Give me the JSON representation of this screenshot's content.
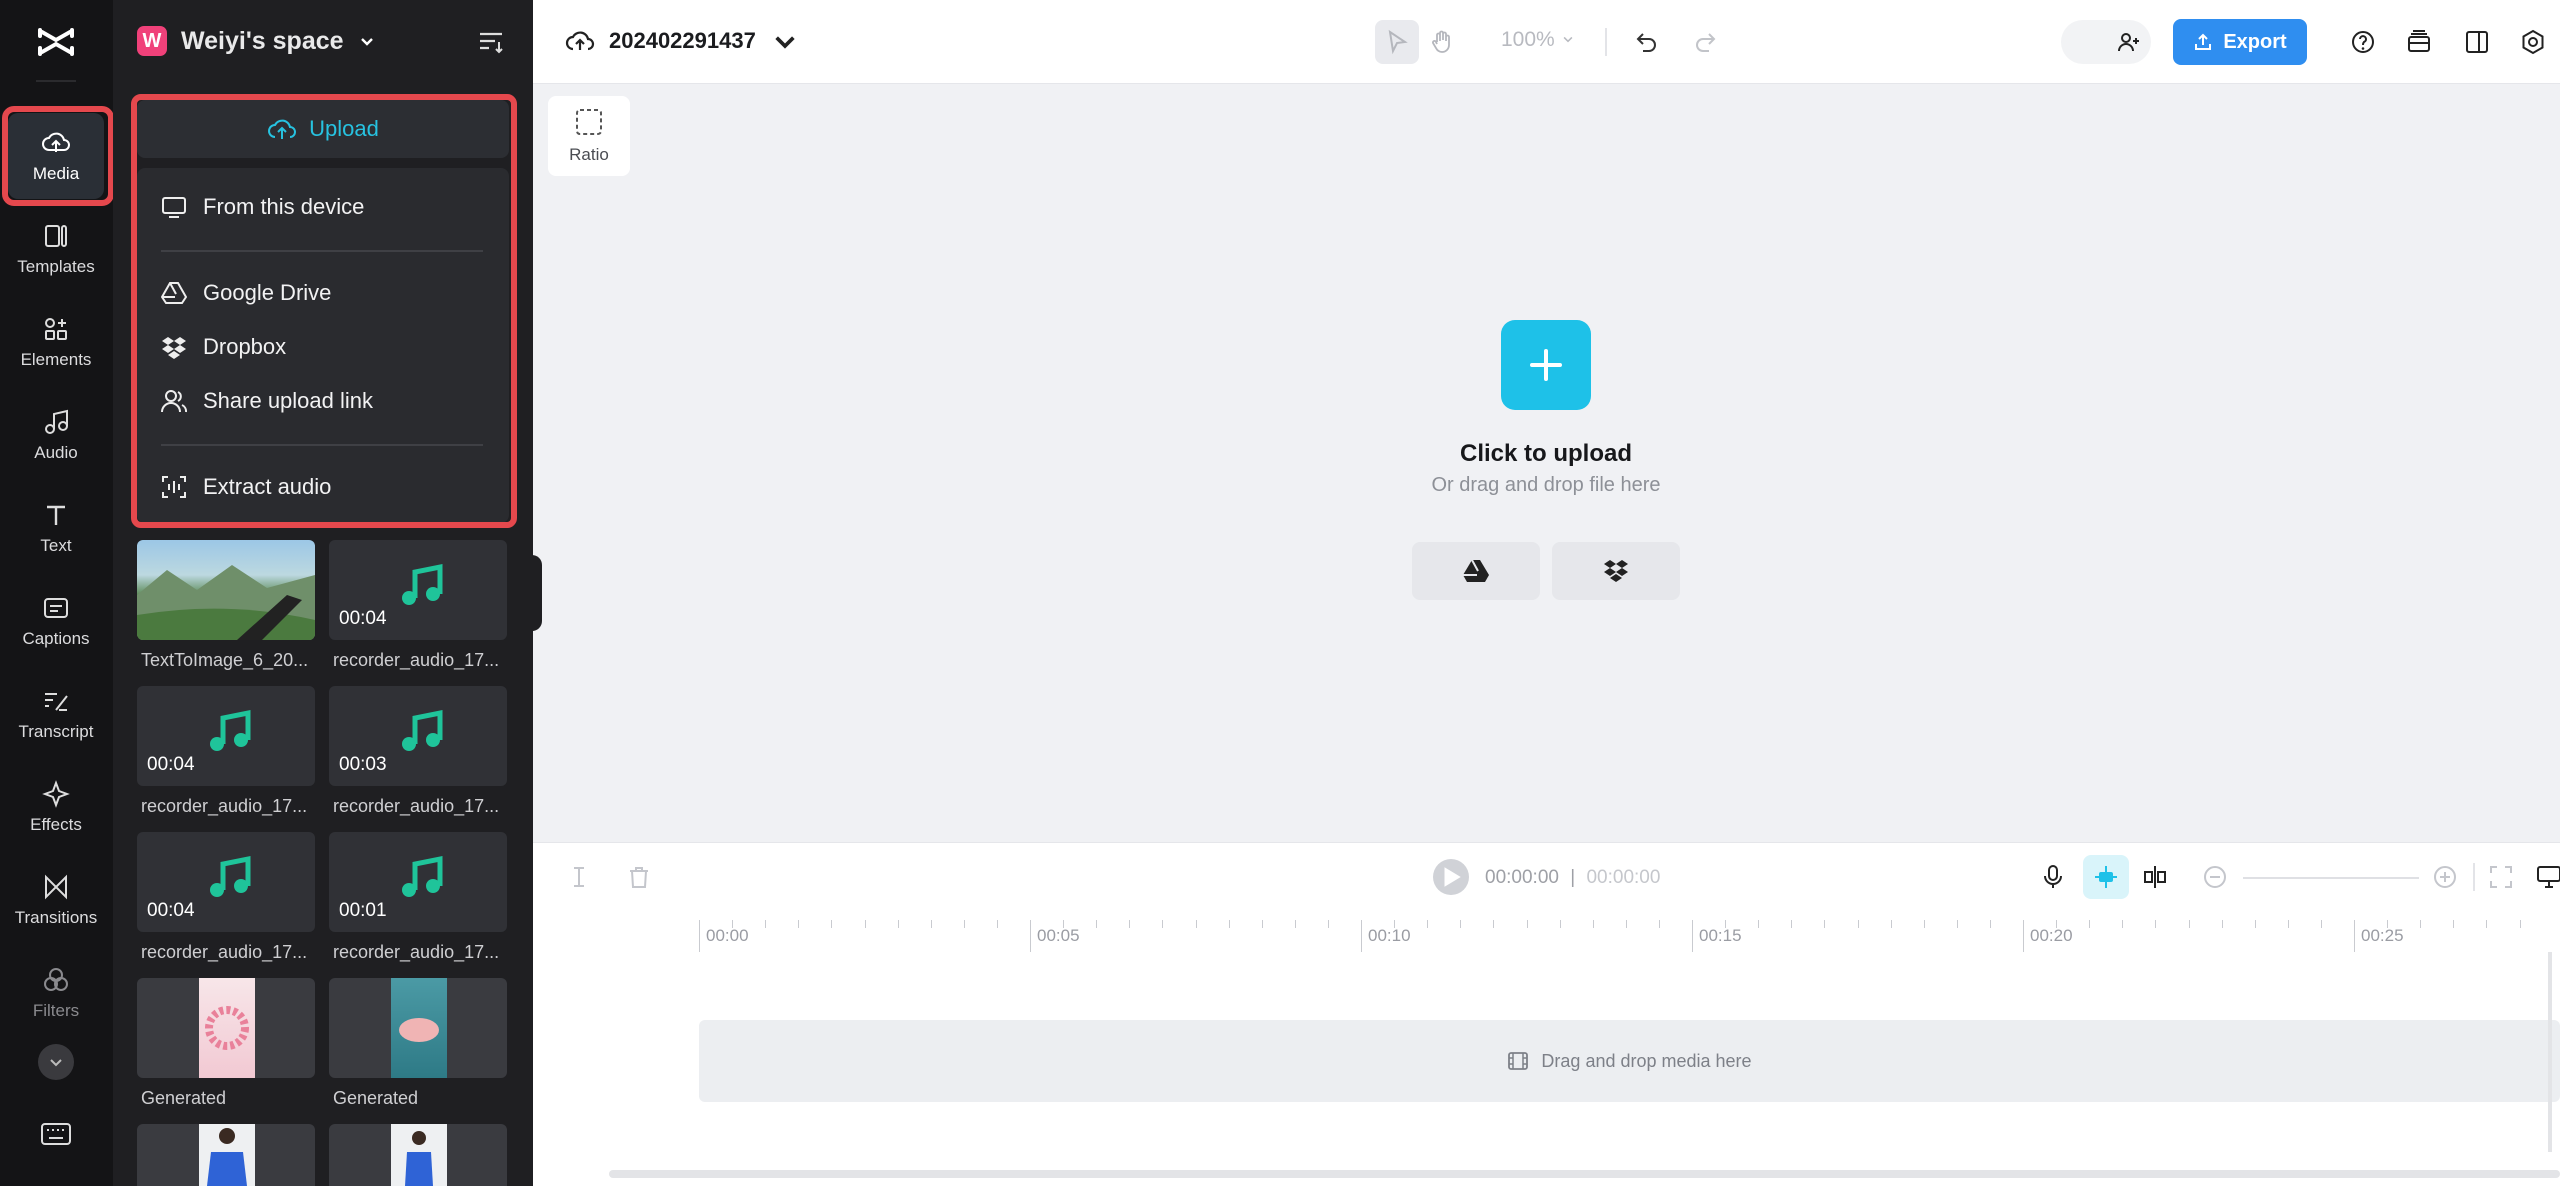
{
  "rail": {
    "items": [
      {
        "label": "Media",
        "icon": "cloud-upload-icon"
      },
      {
        "label": "Templates",
        "icon": "templates-icon"
      },
      {
        "label": "Elements",
        "icon": "elements-icon"
      },
      {
        "label": "Audio",
        "icon": "music-note-icon"
      },
      {
        "label": "Text",
        "icon": "text-icon"
      },
      {
        "label": "Captions",
        "icon": "captions-icon"
      },
      {
        "label": "Transcript",
        "icon": "transcript-icon"
      },
      {
        "label": "Effects",
        "icon": "sparkle-icon"
      },
      {
        "label": "Transitions",
        "icon": "transitions-icon"
      },
      {
        "label": "Filters",
        "icon": "filters-icon"
      }
    ]
  },
  "panel": {
    "workspace": {
      "badge": "W",
      "name": "Weiyi's space"
    },
    "upload_label": "Upload",
    "menu": [
      {
        "label": "From this device",
        "icon": "monitor-icon"
      },
      {
        "label": "Google Drive",
        "icon": "google-drive-icon"
      },
      {
        "label": "Dropbox",
        "icon": "dropbox-icon"
      },
      {
        "label": "Share upload link",
        "icon": "people-icon"
      },
      {
        "label": "Extract audio",
        "icon": "extract-audio-icon"
      }
    ],
    "media": [
      {
        "caption": "TextToImage_6_20...",
        "duration": "",
        "kind": "image"
      },
      {
        "caption": "recorder_audio_17...",
        "duration": "00:04",
        "kind": "audio"
      },
      {
        "caption": "recorder_audio_17...",
        "duration": "00:04",
        "kind": "audio"
      },
      {
        "caption": "recorder_audio_17...",
        "duration": "00:03",
        "kind": "audio"
      },
      {
        "caption": "recorder_audio_17...",
        "duration": "00:04",
        "kind": "audio"
      },
      {
        "caption": "recorder_audio_17...",
        "duration": "00:01",
        "kind": "audio"
      },
      {
        "caption": "Generated",
        "duration": "",
        "kind": "generated-pink"
      },
      {
        "caption": "Generated",
        "duration": "",
        "kind": "generated-teal"
      },
      {
        "caption": "",
        "duration": "",
        "kind": "person"
      },
      {
        "caption": "",
        "duration": "",
        "kind": "person"
      }
    ]
  },
  "topbar": {
    "project_name": "202402291437",
    "zoom": "100%",
    "export_label": "Export"
  },
  "canvas": {
    "ratio_label": "Ratio",
    "upload_title": "Click to upload",
    "upload_subtitle": "Or drag and drop file here"
  },
  "timeline": {
    "current_time": "00:00:00",
    "separator": "|",
    "total_time": "00:00:00",
    "ruler": [
      "00:00",
      "00:05",
      "00:10",
      "00:15",
      "00:20",
      "00:25"
    ],
    "drop_hint": "Drag and drop media here"
  },
  "colors": {
    "accent": "#27c2e0",
    "highlight": "#e5484d",
    "export": "#2f8ef0",
    "audio_note": "#1fc49a"
  }
}
